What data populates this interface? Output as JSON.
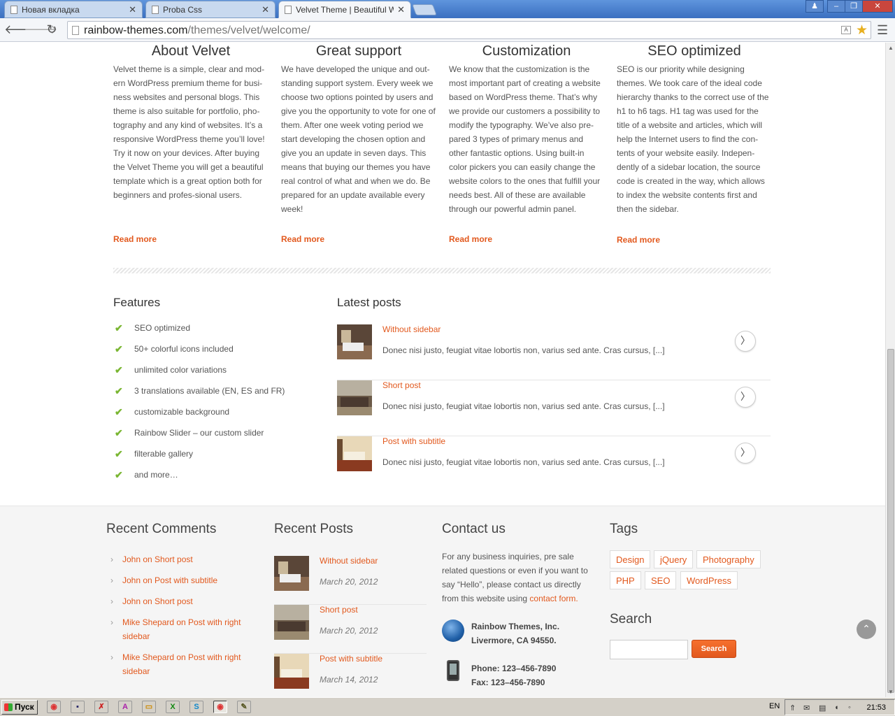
{
  "browser": {
    "tabs": [
      {
        "title": "Новая вкладка"
      },
      {
        "title": "Proba Css"
      },
      {
        "title": "Velvet Theme | Beautiful We"
      }
    ],
    "url_host": "rainbow-themes.com",
    "url_path": "/themes/velvet/welcome/"
  },
  "columns": [
    {
      "title": "About Velvet",
      "text": "Velvet theme is a simple, clear and mod-ern WordPress premium theme for busi-ness websites and personal blogs. This theme is also suitable for portfolio, pho-tography and any kind of websites. It’s a responsive WordPress theme you’ll love! Try it now on your devices. After buying the Velvet Theme you will get a beautiful template which is a great option both for beginners and profes-sional users.",
      "link": "Read more"
    },
    {
      "title": "Great support",
      "text": "We have developed the unique and out-standing support system. Every week we choose two options pointed by users and give you the opportunity to vote for one of them. After one week voting period we start developing the chosen option and give you an update in seven days. This means that buying our themes you have real control of what and when we do. Be prepared for an update available every week!",
      "link": "Read more"
    },
    {
      "title": "Customization",
      "text": "We know that the customization is the most important part of creating a website based on WordPress theme. That’s why we provide our customers a possibility to modify the typography. We’ve also pre-pared 3 types of primary menus and other fantastic options. Using built-in color pickers you can easily change the website colors to the ones that fulfill your needs best. All of these are available through our powerful admin panel.",
      "link": "Read more"
    },
    {
      "title": "SEO optimized",
      "text": "SEO is our priority while designing themes. We took care of the ideal code hierarchy thanks to the correct use of the h1 to h6 tags. H1 tag was used for the title of a website and articles, which will help the Internet users to find the con-tents of your website easily. Indepen-dently of a sidebar location, the source code is created in the way, which allows to index the website contents first and then the sidebar.",
      "link": "Read more"
    }
  ],
  "features": {
    "title": "Features",
    "items": [
      "SEO optimized",
      "50+ colorful icons included",
      "unlimited color variations",
      "3 translations available (EN, ES and FR)",
      "customizable background",
      "Rainbow Slider – our custom slider",
      "filterable gallery",
      "and more…"
    ]
  },
  "latest_posts": {
    "title": "Latest posts",
    "items": [
      {
        "title": "Without sidebar",
        "excerpt": "Donec nisi justo, feugiat vitae lobortis non, varius sed ante. Cras cursus, [...]"
      },
      {
        "title": "Short post",
        "excerpt": "Donec nisi justo, feugiat vitae lobortis non, varius sed ante. Cras cursus, [...]"
      },
      {
        "title": "Post with subtitle",
        "excerpt": "Donec nisi justo, feugiat vitae lobortis non, varius sed ante. Cras cursus, [...]"
      }
    ]
  },
  "footer": {
    "recent_comments": {
      "title": "Recent Comments",
      "items": [
        "John on Short post",
        "John on Post with subtitle",
        "John on Short post",
        "Mike Shepard on Post with right sidebar",
        "Mike Shepard on Post with right sidebar"
      ]
    },
    "recent_posts": {
      "title": "Recent Posts",
      "items": [
        {
          "title": "Without sidebar",
          "date": "March 20, 2012"
        },
        {
          "title": "Short post",
          "date": "March 20, 2012"
        },
        {
          "title": "Post with subtitle",
          "date": "March 14, 2012"
        }
      ]
    },
    "contact": {
      "title": "Contact us",
      "text": "For any business inquiries, pre sale related questions or even if you want to say “Hello”, please contact us directly from this website using ",
      "link": "contact form.",
      "company": "Rainbow Themes, Inc.",
      "city": "Livermore, CA 94550.",
      "phone": "Phone: 123–456-7890",
      "fax": "Fax: 123–456-7890"
    },
    "tags": {
      "title": "Tags",
      "items": [
        "Design",
        "jQuery",
        "Photography",
        "PHP",
        "SEO",
        "WordPress"
      ]
    },
    "search": {
      "title": "Search",
      "button": "Search"
    }
  },
  "taskbar": {
    "start": "Пуск",
    "lang": "EN",
    "clock": "21:53"
  },
  "colors": {
    "accent": "#e2591e",
    "check": "#7ab632"
  }
}
